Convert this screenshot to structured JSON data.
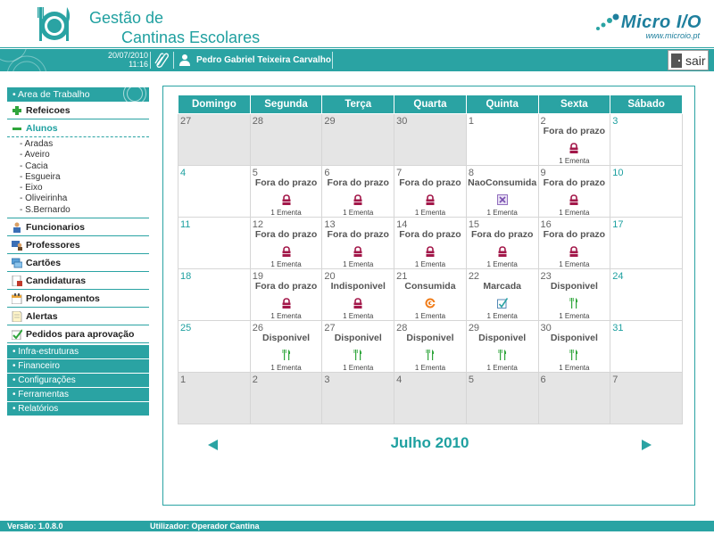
{
  "app": {
    "title_line1": "Gestão de",
    "title_line2": "Cantinas Escolares",
    "vendor_name": "Micro I/O",
    "vendor_url": "www.microio.pt"
  },
  "infobar": {
    "date": "20/07/2010",
    "time": "11:16",
    "user_name": "Pedro Gabriel Teixeira Carvalho",
    "exit_label": "sair"
  },
  "sidebar": {
    "header": "• Area de Trabalho",
    "items": [
      {
        "label": "Refeicoes",
        "icon": "plus-icon"
      },
      {
        "label": "Alunos",
        "icon": "minus-icon",
        "active": true
      },
      {
        "label": "Funcionarios",
        "icon": "employees-icon"
      },
      {
        "label": "Professores",
        "icon": "teachers-icon"
      },
      {
        "label": "Cartões",
        "icon": "cards-icon"
      },
      {
        "label": "Candidaturas",
        "icon": "applications-icon"
      },
      {
        "label": "Prolongamentos",
        "icon": "extensions-icon"
      },
      {
        "label": "Alertas",
        "icon": "alerts-icon"
      },
      {
        "label": "Pedidos para aprovação",
        "icon": "approval-check-icon"
      }
    ],
    "alunos_sub": [
      "- Aradas",
      "- Aveiro",
      "- Cacia",
      "- Esgueira",
      "- Eixo",
      "- Oliveirinha",
      "- S.Bernardo"
    ],
    "menu": [
      "• Infra-estruturas",
      "• Financeiro",
      "• Configurações",
      "• Ferramentas",
      "• Relatórios"
    ]
  },
  "calendar": {
    "weekdays": [
      "Domingo",
      "Segunda",
      "Terça",
      "Quarta",
      "Quinta",
      "Sexta",
      "Sábado"
    ],
    "month_label": "Julho 2010",
    "weeks": [
      [
        {
          "day": "27",
          "other": true
        },
        {
          "day": "28",
          "other": true
        },
        {
          "day": "29",
          "other": true
        },
        {
          "day": "30",
          "other": true
        },
        {
          "day": "1"
        },
        {
          "day": "2",
          "status": "Fora do prazo",
          "icon": "lock",
          "ementa": "1 Ementa"
        },
        {
          "day": "3",
          "weekend": true
        }
      ],
      [
        {
          "day": "4",
          "weekend": true
        },
        {
          "day": "5",
          "status": "Fora do prazo",
          "icon": "lock",
          "ementa": "1 Ementa"
        },
        {
          "day": "6",
          "status": "Fora do prazo",
          "icon": "lock",
          "ementa": "1 Ementa"
        },
        {
          "day": "7",
          "status": "Fora do prazo",
          "icon": "lock",
          "ementa": "1 Ementa"
        },
        {
          "day": "8",
          "status": "NaoConsumida",
          "icon": "cross",
          "ementa": "1 Ementa"
        },
        {
          "day": "9",
          "status": "Fora do prazo",
          "icon": "lock",
          "ementa": "1 Ementa"
        },
        {
          "day": "10",
          "weekend": true
        }
      ],
      [
        {
          "day": "11",
          "weekend": true
        },
        {
          "day": "12",
          "status": "Fora do prazo",
          "icon": "lock",
          "ementa": "1 Ementa"
        },
        {
          "day": "13",
          "status": "Fora do prazo",
          "icon": "lock",
          "ementa": "1 Ementa"
        },
        {
          "day": "14",
          "status": "Fora do prazo",
          "icon": "lock",
          "ementa": "1 Ementa"
        },
        {
          "day": "15",
          "status": "Fora do prazo",
          "icon": "lock",
          "ementa": "1 Ementa"
        },
        {
          "day": "16",
          "status": "Fora do prazo",
          "icon": "lock",
          "ementa": "1 Ementa"
        },
        {
          "day": "17",
          "weekend": true
        }
      ],
      [
        {
          "day": "18",
          "weekend": true
        },
        {
          "day": "19",
          "status": "Fora do prazo",
          "icon": "lock",
          "ementa": "1 Ementa"
        },
        {
          "day": "20",
          "status": "Indisponivel",
          "icon": "lock",
          "ementa": "1 Ementa"
        },
        {
          "day": "21",
          "status": "Consumida",
          "icon": "consumed",
          "ementa": "1 Ementa"
        },
        {
          "day": "22",
          "status": "Marcada",
          "icon": "check",
          "ementa": "1 Ementa"
        },
        {
          "day": "23",
          "status": "Disponivel",
          "icon": "cutlery",
          "ementa": "1 Ementa"
        },
        {
          "day": "24",
          "weekend": true
        }
      ],
      [
        {
          "day": "25",
          "weekend": true
        },
        {
          "day": "26",
          "status": "Disponivel",
          "icon": "cutlery",
          "ementa": "1 Ementa"
        },
        {
          "day": "27",
          "status": "Disponivel",
          "icon": "cutlery",
          "ementa": "1 Ementa"
        },
        {
          "day": "28",
          "status": "Disponivel",
          "icon": "cutlery",
          "ementa": "1 Ementa"
        },
        {
          "day": "29",
          "status": "Disponivel",
          "icon": "cutlery",
          "ementa": "1 Ementa"
        },
        {
          "day": "30",
          "status": "Disponivel",
          "icon": "cutlery",
          "ementa": "1 Ementa"
        },
        {
          "day": "31",
          "weekend": true
        }
      ],
      [
        {
          "day": "1",
          "other": true
        },
        {
          "day": "2",
          "other": true
        },
        {
          "day": "3",
          "other": true
        },
        {
          "day": "4",
          "other": true
        },
        {
          "day": "5",
          "other": true
        },
        {
          "day": "6",
          "other": true
        },
        {
          "day": "7",
          "other": true
        }
      ]
    ]
  },
  "footer": {
    "version": "Versão: 1.0.8.0",
    "user": "Utilizador: Operador Cantina"
  },
  "colors": {
    "accent": "#2aa3a3",
    "lock": "#a3184a",
    "available": "#2fa53b",
    "other_month": "#e5e5e5"
  }
}
